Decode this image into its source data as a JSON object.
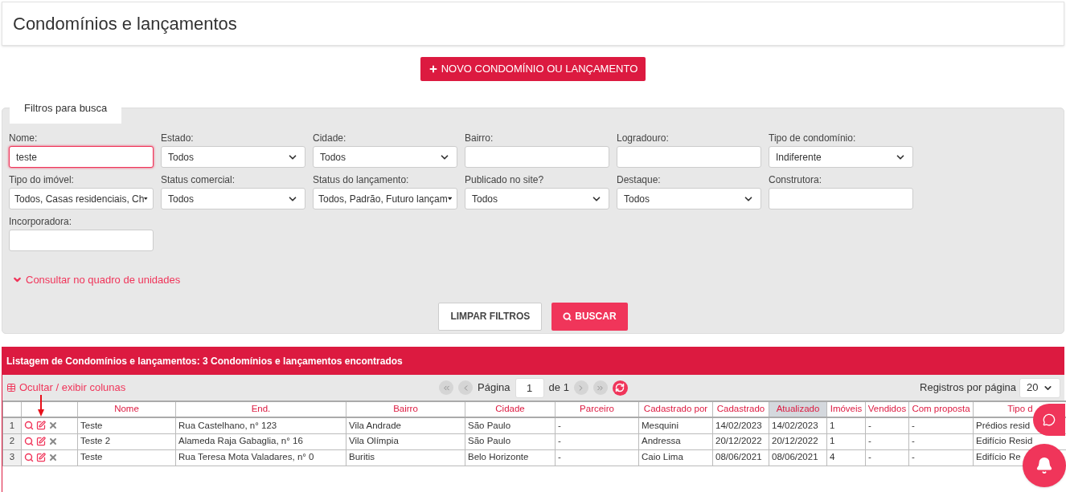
{
  "page_title": "Condomínios e lançamentos",
  "new_button": "NOVO CONDOMÍNIO OU LANÇAMENTO",
  "filters": {
    "tab": "Filtros para busca",
    "fields": [
      {
        "label": "Nome:",
        "kind": "text",
        "value": "teste",
        "focused": true
      },
      {
        "label": "Estado:",
        "kind": "select",
        "value": "Todos",
        "focused": false
      },
      {
        "label": "Cidade:",
        "kind": "select",
        "value": "Todos",
        "focused": false
      },
      {
        "label": "Bairro:",
        "kind": "text",
        "focused": false
      },
      {
        "label": "Logradouro:",
        "kind": "text",
        "focused": false
      },
      {
        "label": "Tipo de condomínio:",
        "kind": "select",
        "value": "Indiferente",
        "focused": false
      },
      {
        "label": "Tipo do imóvel:",
        "kind": "multiselect",
        "value": "Todos, Casas residenciais, Ch",
        "focused": false
      },
      {
        "label": "Status comercial:",
        "kind": "select",
        "value": "Todos",
        "focused": false
      },
      {
        "label": "Status do lançamento:",
        "kind": "multiselect",
        "value": "Todos, Padrão, Futuro lançam",
        "focused": false
      },
      {
        "label": "Publicado no site?",
        "kind": "select",
        "value": "Todos",
        "focused": false
      },
      {
        "label": "Destaque:",
        "kind": "select",
        "value": "Todos",
        "focused": false
      },
      {
        "label": "Construtora:",
        "kind": "text",
        "focused": false
      },
      {
        "label": "Incorporadora:",
        "kind": "text",
        "focused": false
      }
    ],
    "units_link": "Consultar no quadro de unidades",
    "clear_button": "LIMPAR FILTROS",
    "search_button": "BUSCAR"
  },
  "listing": {
    "title": "Listagem de Condomínios e lançamentos: 3 Condomínios e lançamentos encontrados",
    "columns_toggle": "Ocultar / exibir colunas",
    "page_label": "Página",
    "page": "1",
    "page_total": "de 1",
    "per_page_label": "Registros por página",
    "per_page": "20",
    "columns": [
      {
        "label": "Nome",
        "sorted": false
      },
      {
        "label": "End.",
        "sorted": false
      },
      {
        "label": "Bairro",
        "sorted": false
      },
      {
        "label": "Cidade",
        "sorted": false
      },
      {
        "label": "Parceiro",
        "sorted": false
      },
      {
        "label": "Cadastrado por",
        "sorted": false
      },
      {
        "label": "Cadastrado",
        "sorted": false
      },
      {
        "label": "Atualizado",
        "sorted": true
      },
      {
        "label": "Imóveis",
        "sorted": false
      },
      {
        "label": "Vendidos",
        "sorted": false
      },
      {
        "label": "Com proposta",
        "sorted": false
      },
      {
        "label": "Tipo d",
        "sorted": false
      }
    ],
    "rows": [
      {
        "index": "1",
        "cells": [
          "Teste",
          "Rua Castelhano, n° 123",
          "Vila Andrade",
          "São Paulo",
          "-",
          "Mesquini",
          "14/02/2023",
          "14/02/2023",
          "1",
          "-",
          "-",
          "Prédios resid"
        ]
      },
      {
        "index": "2",
        "cells": [
          "Teste 2",
          "Alameda Raja Gabaglia, n° 16",
          "Vila Olímpia",
          "São Paulo",
          "-",
          "Andressa",
          "20/12/2022",
          "20/12/2022",
          "1",
          "-",
          "-",
          "Edifício Resid"
        ]
      },
      {
        "index": "3",
        "cells": [
          "Teste",
          "Rua Teresa Mota Valadares, n° 0",
          "Buritis",
          "Belo Horizonte",
          "-",
          "Caio Lima",
          "08/06/2021",
          "08/06/2021",
          "4",
          "-",
          "-",
          "Edifício Re"
        ]
      }
    ]
  }
}
